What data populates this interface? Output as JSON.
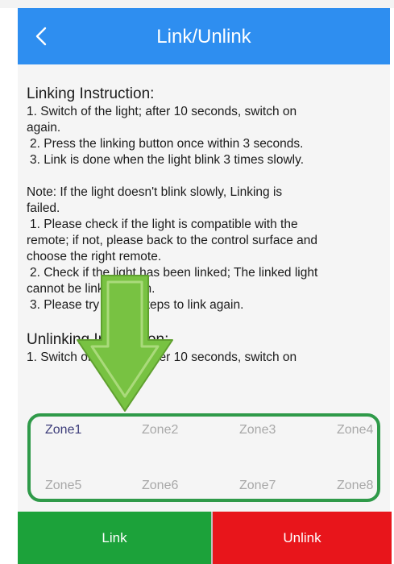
{
  "header": {
    "back_label": "<",
    "title": "Link/Unlink"
  },
  "instructions": {
    "linking_title": "Linking Instruction:",
    "linking_steps": [
      "1. Switch of the light; after 10 seconds, switch on",
      "again.",
      " 2. Press the linking button once within 3 seconds.",
      " 3. Link is done when the light blink 3 times slowly."
    ],
    "note_lines": [
      " Note: If the light doesn't blink slowly, Linking is",
      "failed.",
      " 1. Please check if the light is compatible with the",
      "remote; if not, please back to the control surface and",
      "choose the right remote.",
      " 2. Check if the light has been linked; The linked light",
      "cannot be linked again.",
      " 3. Please try above steps to link again."
    ],
    "unlinking_title": "Unlinking Instruction:",
    "unlinking_steps": [
      "1. Switch of the light; after 10 seconds, switch on"
    ]
  },
  "zones": {
    "items": [
      "Zone1",
      "Zone2",
      "Zone3",
      "Zone4",
      "Zone5",
      "Zone6",
      "Zone7",
      "Zone8"
    ],
    "selected": "Zone1"
  },
  "actions": {
    "link_label": "Link",
    "unlink_label": "Unlink"
  },
  "colors": {
    "header": "#2e8ef0",
    "link": "#1ca23a",
    "unlink": "#e8151b",
    "arrow": "#78c242",
    "zone_border": "#2f9a49"
  },
  "icons": {
    "back": "back-chevron-icon",
    "arrow": "down-arrow-icon"
  }
}
